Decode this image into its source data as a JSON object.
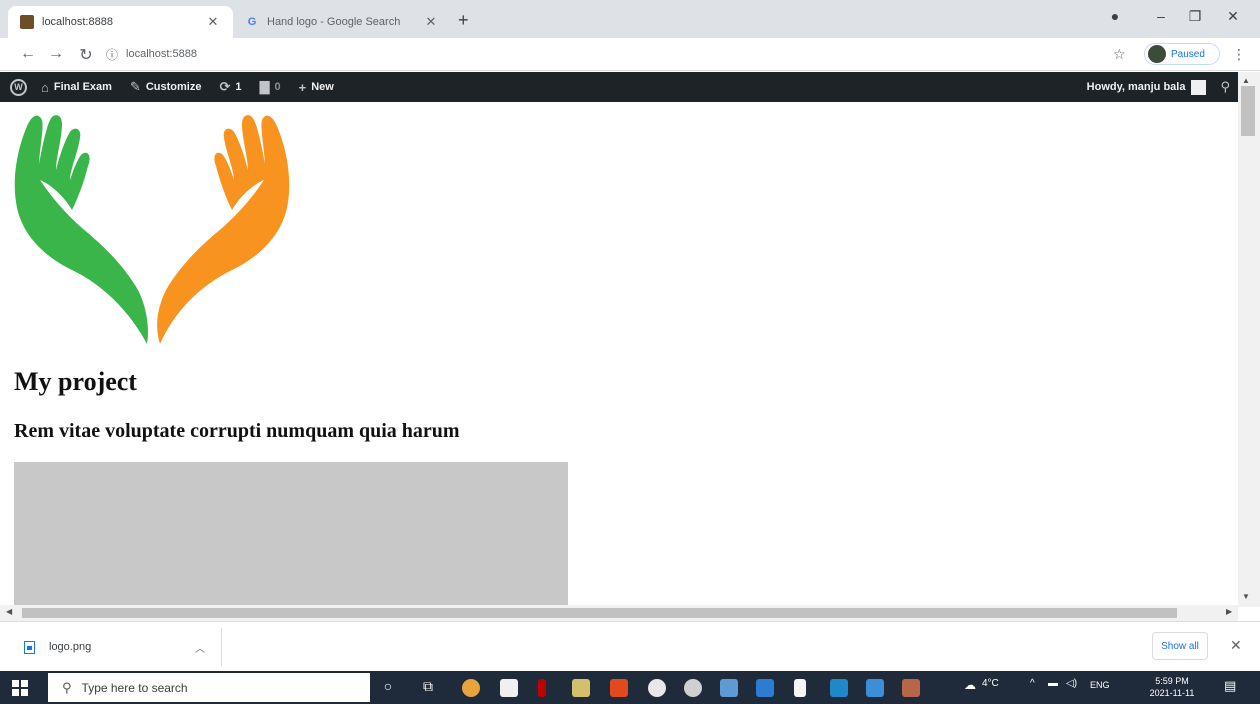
{
  "browser": {
    "tabs": [
      {
        "title": "localhost:8888",
        "active": true
      },
      {
        "title": "Hand logo - Google Search",
        "active": false
      }
    ],
    "url": "localhost:5888",
    "profile_label": "Paused"
  },
  "adminbar": {
    "site_name": "Final Exam",
    "customize": "Customize",
    "updates_count": "1",
    "comments_count": "0",
    "new_label": "New",
    "howdy": "Howdy, manju bala"
  },
  "page": {
    "site_title": "My project",
    "tagline": "Rem vitae voluptate corrupti numquam quia harum",
    "logo_colors": {
      "left_hand": "#3ab54a",
      "right_hand": "#f7931e"
    }
  },
  "downloads": {
    "file_name": "logo.png",
    "show_all": "Show all"
  },
  "taskbar": {
    "search_placeholder": "Type here to search",
    "weather": "4°C",
    "language": "ENG",
    "time": "5:59 PM",
    "date": "2021-11-11"
  }
}
